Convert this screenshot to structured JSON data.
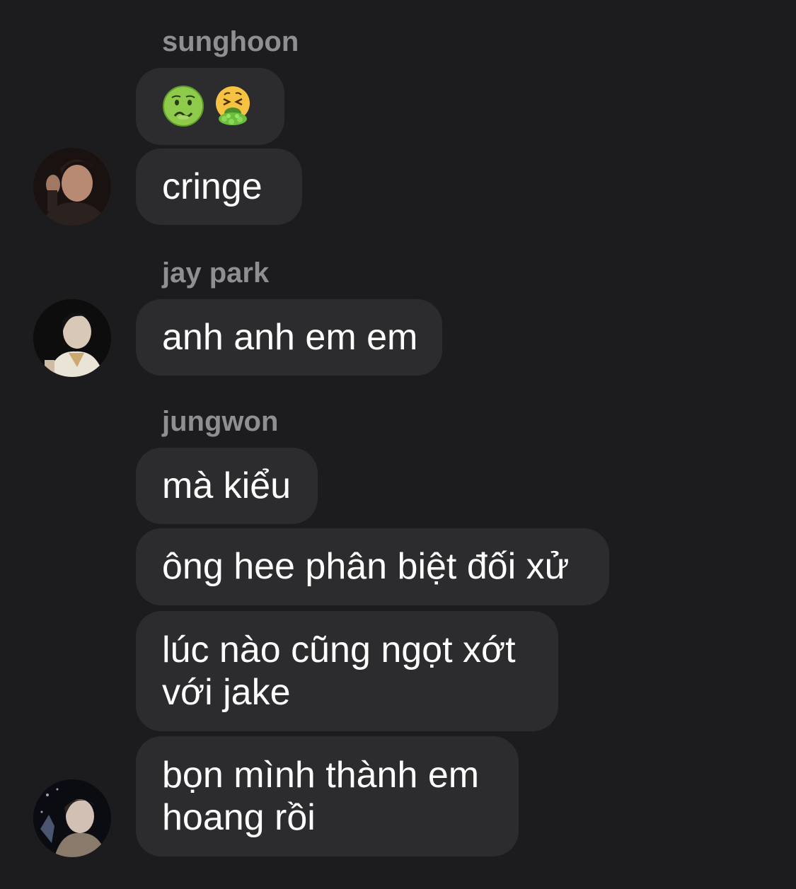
{
  "groups": [
    {
      "sender": "sunghoon",
      "avatar": "sunghoon-avatar",
      "messages": [
        {
          "type": "emoji",
          "emojis": [
            "nauseated-face-icon",
            "face-vomiting-icon"
          ]
        },
        {
          "type": "text",
          "text": "cringe"
        }
      ]
    },
    {
      "sender": "jay park",
      "avatar": "jay-park-avatar",
      "messages": [
        {
          "type": "text",
          "text": "anh anh em em"
        }
      ]
    },
    {
      "sender": "jungwon",
      "avatar": "jungwon-avatar",
      "messages": [
        {
          "type": "text",
          "text": "mà kiểu"
        },
        {
          "type": "text",
          "text": "ông hee phân biệt đối xử"
        },
        {
          "type": "text",
          "lines": [
            "lúc nào cũng ngọt xớt",
            "với jake"
          ]
        },
        {
          "type": "text",
          "lines": [
            "bọn mình thành em",
            "hoang rồi"
          ]
        }
      ]
    }
  ],
  "colors": {
    "background": "#1c1c1e",
    "bubble": "#2c2c2e",
    "sender_name": "#8e8e93",
    "message_text": "#ffffff"
  }
}
